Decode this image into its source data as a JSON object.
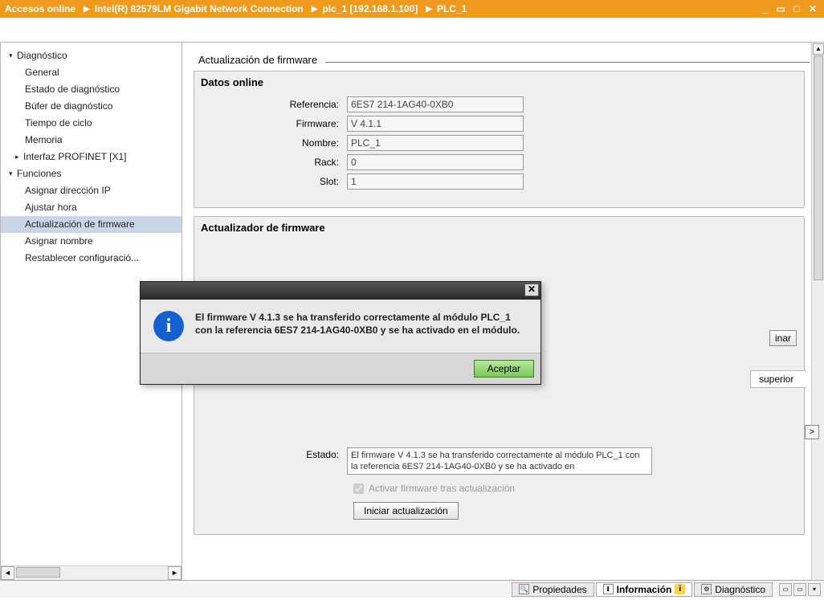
{
  "breadcrumb": {
    "items": [
      "Accesos online",
      "Intel(R) 82579LM Gigabit Network Connection",
      "plc_1 [192.168.1.100]",
      "PLC_1"
    ]
  },
  "tree": {
    "diag": "Diagnóstico",
    "general": "General",
    "estado": "Estado de diagnóstico",
    "bufer": "Búfer de diagnóstico",
    "ciclo": "Tiempo de ciclo",
    "memoria": "Memoria",
    "profinet": "Interfaz PROFINET [X1]",
    "funciones": "Funciones",
    "asignar_ip": "Asignar dirección IP",
    "ajustar_hora": "Ajustar hora",
    "actualizar_fw": "Actualización de firmware",
    "asignar_nombre": "Asignar nombre",
    "restablecer": "Restablecer configuració..."
  },
  "section": {
    "title": "Actualización de firmware"
  },
  "panel1": {
    "title": "Datos online",
    "referencia_label": "Referencia:",
    "referencia": "6ES7 214-1AG40-0XB0",
    "firmware_label": "Firmware:",
    "firmware": "V 4.1.1",
    "nombre_label": "Nombre:",
    "nombre": "PLC_1",
    "rack_label": "Rack:",
    "rack": "0",
    "slot_label": "Slot:",
    "slot": "1"
  },
  "panel2": {
    "title": "Actualizador de firmware",
    "estado_label": "Estado:",
    "estado_text": "El firmware V 4.1.3 se ha transferido correctamente al módulo PLC_1 con la referencia 6ES7 214-1AG40-0XB0 y se ha activado en",
    "activar_chk": "Activar firmware tras actualización",
    "iniciar_btn": "Iniciar actualización"
  },
  "peek": {
    "examinar": "inar",
    "superior": "superior",
    "arrow": ">"
  },
  "modal": {
    "message": "El firmware V 4.1.3 se ha transferido correctamente al módulo PLC_1 con la referencia 6ES7 214-1AG40-0XB0 y se ha activado en el módulo.",
    "accept": "Aceptar"
  },
  "bottombar": {
    "propiedades": "Propiedades",
    "informacion": "Información",
    "diagnostico": "Diagnóstico"
  }
}
